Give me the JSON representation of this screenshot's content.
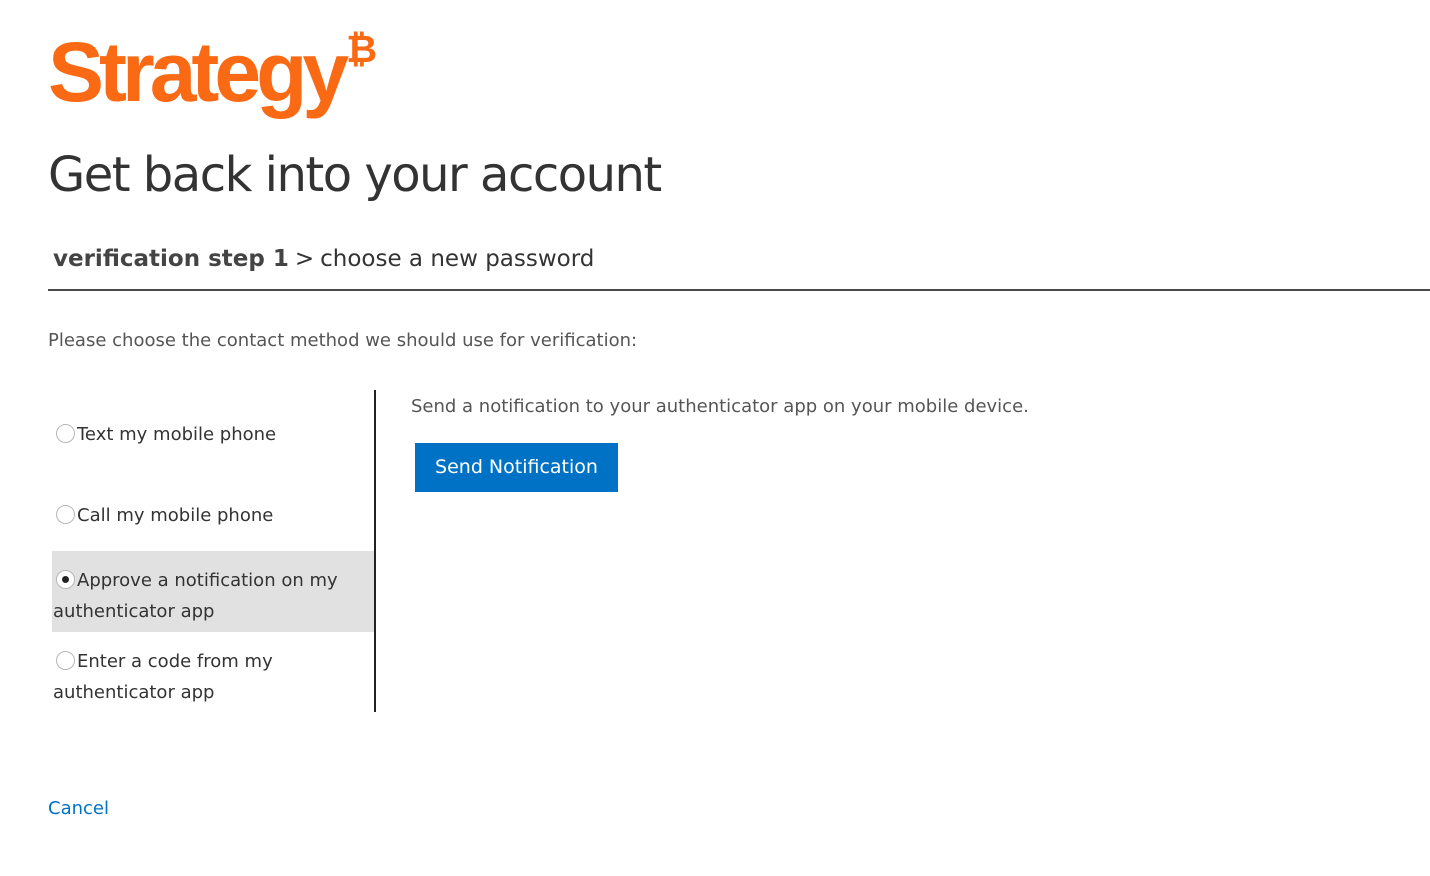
{
  "brand": {
    "logo_text": "Strategy",
    "logo_mark": "₿",
    "color": "#fa6a14"
  },
  "page": {
    "title": "Get back into your account"
  },
  "breadcrumb": {
    "current_step": "verification step 1",
    "separator": ">",
    "next_step": "choose a new password"
  },
  "instructions": "Please choose the contact method we should use for verification:",
  "methods": [
    {
      "label": "Text my mobile phone",
      "selected": false
    },
    {
      "label": "Call my mobile phone",
      "selected": false
    },
    {
      "label": "Approve a notification on my authenticator app",
      "selected": true
    },
    {
      "label": "Enter a code from my authenticator app",
      "selected": false
    }
  ],
  "detail": {
    "description": "Send a notification to your authenticator app on your mobile device.",
    "button_label": "Send Notification",
    "button_color": "#0072c6"
  },
  "footer": {
    "cancel_label": "Cancel"
  },
  "colors": {
    "link": "#0072c6",
    "selected_row": "#e1e1e1"
  }
}
